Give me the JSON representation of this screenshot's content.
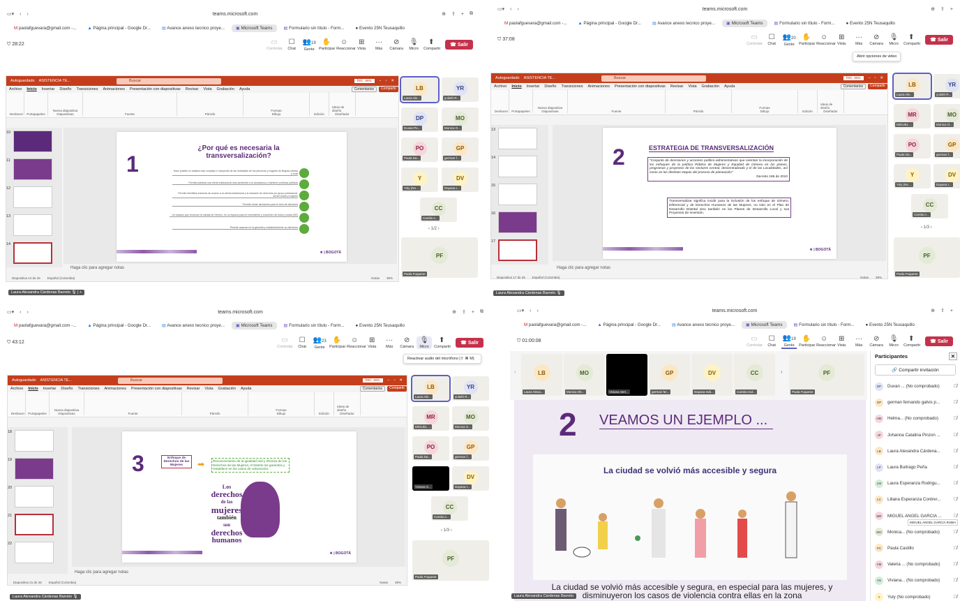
{
  "tabs": [
    {
      "label": "paolafguevara@gmail.com -...",
      "icon": "gmail-icon"
    },
    {
      "label": "Página principal - Google Dr...",
      "icon": "drive-icon"
    },
    {
      "label": "Avance anexo tecnico proye...",
      "icon": "docs-icon"
    },
    {
      "label": "Microsoft Teams",
      "icon": "teams-icon"
    },
    {
      "label": "Formulario sin título - Form...",
      "icon": "forms-icon"
    },
    {
      "label": "Evento 25N Teusaquillo",
      "icon": "event-icon"
    }
  ],
  "url": "teams.microsoft.com",
  "teams_tools": {
    "controlar": "Controlar",
    "chat": "Chat",
    "gente": "Gente",
    "participar": "Participar",
    "reaccionar": "Reaccionar",
    "vista": "Vista",
    "mas": "Más",
    "camara": "Cámara",
    "micro": "Micro",
    "compartir": "Compartir",
    "salir": "Salir"
  },
  "ppt": {
    "autosave": "Autoguardado",
    "file": "ASISTENCIA TE...",
    "search": "Buscar",
    "signin": "Inic. ses.",
    "menus": [
      "Archivo",
      "Inicio",
      "Insertar",
      "Diseño",
      "Transiciones",
      "Animaciones",
      "Presentación con diapositivas",
      "Revisar",
      "Vista",
      "Grabación",
      "Ayuda"
    ],
    "comments": "Comentarios",
    "share": "Compartir",
    "groups": [
      "Deshacer",
      "Portapapeles",
      "Diapositivas",
      "Fuente",
      "Párrafo",
      "Dibujo",
      "Diseñador"
    ],
    "ribbon_btns": {
      "nueva": "Nueva diapositiva",
      "formas": "Formas",
      "organizar": "Organizar",
      "edicion": "Edición",
      "ideas": "Ideas de diseño"
    },
    "notes": "Haga clic para agregar notas",
    "language": "Español (Colombia)",
    "notes_btn": "Notas",
    "zoom": "39%"
  },
  "q1": {
    "timer": "28:22",
    "people": "19",
    "slide_no": "1",
    "title": "¿Por qué es necesaria la transversalización?",
    "rows": [
      "Hace posible un análisis más complejo e incluyente de las realidades de las personas y hogares de Bogotá urbana y rural",
      "Permite plantear una oferta institucional más pertinente a la ciudadanía y mantener políticas públicas",
      "Permite identificar barreras de acceso a la oferta institucional y la situación de derechos por grupo poblacional, sector social y mujeres",
      "Permite tomar decisiones para el ciclo de derechos",
      "Un espacio que reconoce la mirada de Género, es un espacio para el crecimiento y encuentro de todos y todas (SE)",
      "Permite avanzar en la garantía y restablecimiento au derechos"
    ],
    "slide_status": "Diapositiva 14 de 26",
    "thumb_nums": [
      "10",
      "11",
      "12",
      "13",
      "14"
    ],
    "presenter": "Laura Alexandra Cárdenas Barreto",
    "page": "1/2"
  },
  "q2": {
    "timer": "37:08",
    "people": "20",
    "slide_no": "2",
    "title": "ESTRATEGIA DE TRANSVERSALIZACIÓN",
    "quote": "\"Conjunto de decisiones y acciones político-administrativas que orientan la incorporación de los enfoques de la política Pública de Mujeres y Equidad de Género en los planes, programas y proyectos de los sectores central, descentralizado y el de las Localidades, así como en las distintas etapas del proceso de planeación\"",
    "decree": "Decreto 166 de 2010",
    "box2": "Transversalizar significa incidir para la inclusión de los enfoque de Género, Diferencial y de Derechos Humanos de las Mujeres, no solo en el Plan de Desarrollo Distrital sino también en los Planes de Desarrollo Local y sus Proyectos de Inversión.",
    "tooltip": "Abrir opciones de video",
    "slide_status": "Diapositiva 17 de 26",
    "thumb_nums": [
      "13",
      "14",
      "15",
      "16",
      "17"
    ],
    "presenter": "Laura Alexandra Cárdenas Barreto",
    "page": "1/3"
  },
  "q3": {
    "timer": "43:12",
    "people": "23",
    "slide_no": "3",
    "box_label": "Enfoque de Derechos de las Mujeres",
    "box_text": "Reconocimiento de la igualdad real y efectiva de los Derechos de las Mujeres; el Distrito los garantiza y restablece en los casos de vulneración.",
    "art": [
      "Los",
      "derechos",
      "de las",
      "mujeres",
      "también",
      "son",
      "derechos",
      "humanos"
    ],
    "tooltip": "Reactivar audio del micrófono (⇧ ⌘ M)",
    "slide_status": "Diapositiva 21 de 26",
    "thumb_nums": [
      "18",
      "19",
      "20",
      "21",
      "22"
    ],
    "presenter": "Laura Alexandra Cárdenas Barreto",
    "page": "1/3"
  },
  "q4": {
    "timer": "01:00:08",
    "people": "19",
    "slide_no": "2",
    "slide_title": "VEAMOS UN EJEMPLO ...",
    "img_caption": "La ciudad se volvió más accesible y segura",
    "caption": "La ciudad se volvió más accesible y segura, en especial para las mujeres, y disminuyeron los casos de violencia contra ellas en la zona",
    "presenter": "Laura Alexandra Cárdenas Barreto",
    "strip": [
      {
        "i": "LB",
        "n": "Laura Alexa..."
      },
      {
        "i": "MO",
        "n": "Monica Ob..."
      },
      {
        "i": "",
        "n": "Viviana Serr..."
      },
      {
        "i": "GP",
        "n": "german fer..."
      },
      {
        "i": "DV",
        "n": "Dayana Indi..."
      },
      {
        "i": "CC",
        "n": "Camila And..."
      }
    ],
    "pf": {
      "i": "PF",
      "n": "Paola Fuquene"
    },
    "panel_title": "Participantes",
    "invite": "Compartir invitación",
    "tooltip": "MIGUEL ANGEL GARCIA RUBIA",
    "participants": [
      {
        "i": "DP",
        "n": "Duvan ... (No comprobado)",
        "c": "#dfe3f5"
      },
      {
        "i": "GP",
        "n": "german fernando galvis p...",
        "c": "#fbe7c6"
      },
      {
        "i": "HM",
        "n": "Helma... (No comprobado)",
        "c": "#f5d6db"
      },
      {
        "i": "JP",
        "n": "Johanna Catalina Pinzon ...",
        "c": "#f5d6db"
      },
      {
        "i": "LB",
        "n": "Laura Alexandra Cárdena...",
        "c": "#fbe7c6"
      },
      {
        "i": "LP",
        "n": "Laura Buitrago Peña",
        "c": "#dfe3f5"
      },
      {
        "i": "LM",
        "n": "Laura Esperanza Rodrigu...",
        "c": "#d4ecd9"
      },
      {
        "i": "LC",
        "n": "Liliana Esperanza Contrer...",
        "c": "#fbe7c6"
      },
      {
        "i": "MR",
        "n": "MIGUEL ANGEL GARCIA ...",
        "c": "#f5d6db"
      },
      {
        "i": "MO",
        "n": "Monica... (No comprobado)",
        "c": "#e3ead6"
      },
      {
        "i": "PC",
        "n": "Paula Castillo",
        "c": "#fbe7c6"
      },
      {
        "i": "VM",
        "n": "Valeria ... (No comprobado)",
        "c": "#f5d6db"
      },
      {
        "i": "VS",
        "n": "Viviana... (No comprobado)",
        "c": "#d4ecd9"
      },
      {
        "i": "Y",
        "n": "Yuly (No comprobado)",
        "c": "#fff3c4"
      }
    ]
  },
  "gallery": {
    "q1": [
      {
        "i": "LB",
        "n": "Laura Ale...",
        "c": "#fbe7c6",
        "t": "#8a5a00"
      },
      {
        "i": "YR",
        "n": "yulieth R...",
        "c": "#dfe3f5",
        "t": "#33407a"
      },
      {
        "i": "DP",
        "n": "Duvan Pe...",
        "c": "#dfe3f5",
        "t": "#33407a"
      },
      {
        "i": "MO",
        "n": "Monica O...",
        "c": "#e3ead6",
        "t": "#4a5a2a"
      },
      {
        "i": "PO",
        "n": "Paula Da...",
        "c": "#f5d6db",
        "t": "#8a2040"
      },
      {
        "i": "GP",
        "n": "german f...",
        "c": "#fbe7c6",
        "t": "#8a5a00"
      },
      {
        "i": "Y",
        "n": "Yuly (No ...",
        "c": "#fff3c4",
        "t": "#806000"
      },
      {
        "i": "DV",
        "n": "Dayana I...",
        "c": "#fff3c4",
        "t": "#806000"
      },
      {
        "i": "CC",
        "n": "Camila A...",
        "c": "#e3ead6",
        "t": "#4a5a2a"
      }
    ],
    "q2": [
      {
        "i": "LB",
        "n": "Laura Ale...",
        "c": "#fbe7c6",
        "t": "#8a5a00"
      },
      {
        "i": "YR",
        "n": "yulieth R...",
        "c": "#dfe3f5",
        "t": "#33407a"
      },
      {
        "i": "MR",
        "n": "MIGUEL ...",
        "c": "#f5d6db",
        "t": "#8a2040"
      },
      {
        "i": "MO",
        "n": "Monica O...",
        "c": "#e3ead6",
        "t": "#4a5a2a"
      },
      {
        "i": "PO",
        "n": "Paula Da...",
        "c": "#f5d6db",
        "t": "#8a2040"
      },
      {
        "i": "GP",
        "n": "german f...",
        "c": "#fbe7c6",
        "t": "#8a5a00"
      },
      {
        "i": "Y",
        "n": "Yuly (No ...",
        "c": "#fff3c4",
        "t": "#806000"
      },
      {
        "i": "DV",
        "n": "Dayana I...",
        "c": "#fff3c4",
        "t": "#806000"
      },
      {
        "i": "CC",
        "n": "Camila A...",
        "c": "#e3ead6",
        "t": "#4a5a2a"
      }
    ],
    "q3": [
      {
        "i": "LB",
        "n": "Laura Ale...",
        "c": "#fbe7c6",
        "t": "#8a5a00"
      },
      {
        "i": "YR",
        "n": "yulieth R...",
        "c": "#dfe3f5",
        "t": "#33407a"
      },
      {
        "i": "MR",
        "n": "MIGUEL ...",
        "c": "#f5d6db",
        "t": "#8a2040"
      },
      {
        "i": "MO",
        "n": "Monica O...",
        "c": "#e3ead6",
        "t": "#4a5a2a"
      },
      {
        "i": "PO",
        "n": "Paula Da...",
        "c": "#f5d6db",
        "t": "#8a2040"
      },
      {
        "i": "GP",
        "n": "german f...",
        "c": "#fbe7c6",
        "t": "#8a5a00"
      },
      {
        "i": "",
        "n": "Viviana S...",
        "c": "#000",
        "t": "#fff"
      },
      {
        "i": "DV",
        "n": "Dayana I...",
        "c": "#fff3c4",
        "t": "#806000"
      },
      {
        "i": "CC",
        "n": "Camila A...",
        "c": "#e3ead6",
        "t": "#4a5a2a"
      }
    ],
    "pf": {
      "i": "PF",
      "n": "Paola Fuquene"
    }
  },
  "colors": {
    "accent": "#5b5fc7",
    "ppt": "#c43e1c",
    "purple": "#5c2a7a",
    "leave": "#c4314b",
    "green": "#5dab3c"
  }
}
